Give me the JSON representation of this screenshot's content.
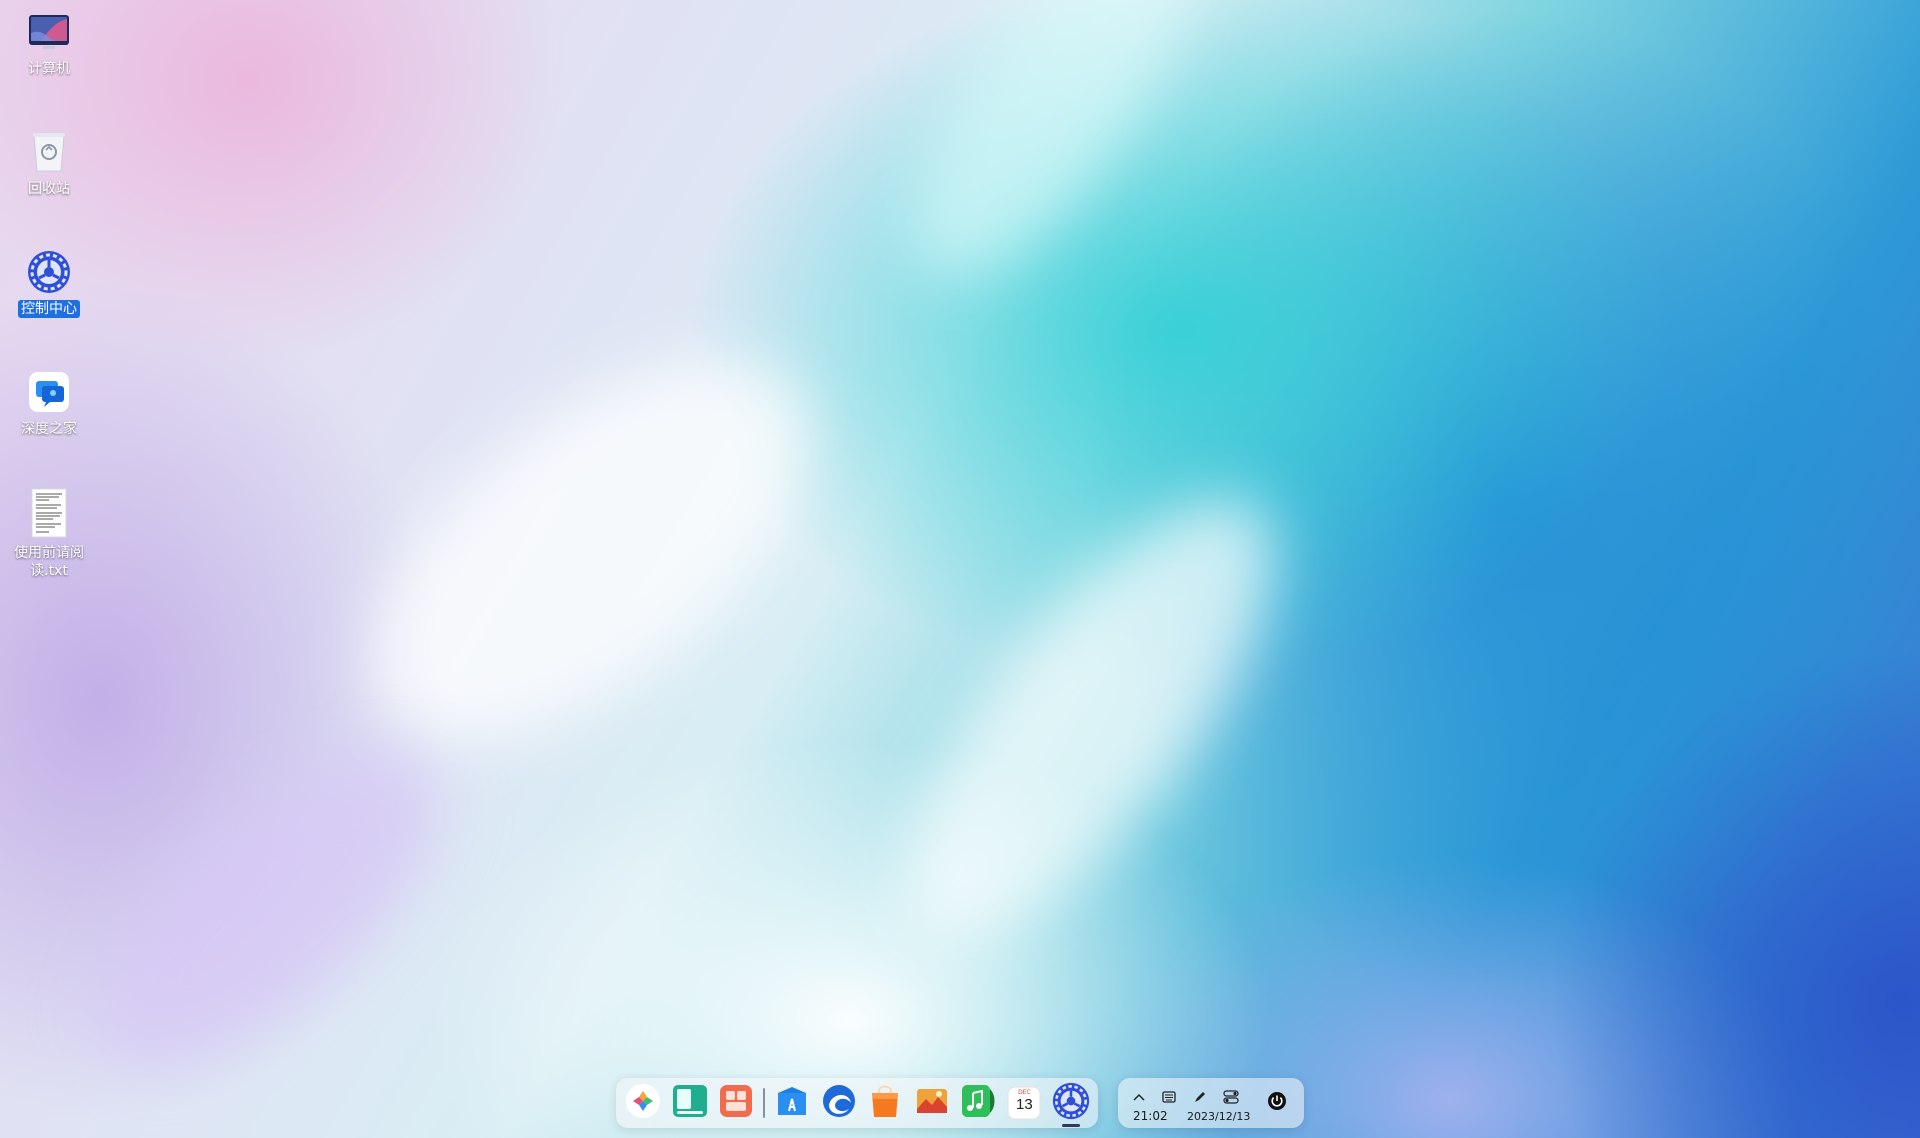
{
  "desktop": {
    "icons": [
      {
        "label": "计算机",
        "icon": "computer-icon",
        "selected": false
      },
      {
        "label": "回收站",
        "icon": "trash-icon",
        "selected": false
      },
      {
        "label": "控制中心",
        "icon": "control-center-icon",
        "selected": true
      },
      {
        "label": "深度之家",
        "icon": "deepin-home-icon",
        "selected": false
      },
      {
        "label": "使用前请阅读.txt",
        "icon": "text-file-icon",
        "selected": false
      }
    ]
  },
  "dock": {
    "apps": [
      {
        "name": "launcher",
        "icon": "launcher-icon"
      },
      {
        "name": "multitasking",
        "icon": "multitasking-icon"
      },
      {
        "name": "file-manager",
        "icon": "file-manager-icon"
      },
      {
        "name": "app-store",
        "icon": "app-store-icon"
      },
      {
        "name": "browser",
        "icon": "browser-icon"
      },
      {
        "name": "shopping",
        "icon": "shopping-bag-icon"
      },
      {
        "name": "image-viewer",
        "icon": "image-viewer-icon"
      },
      {
        "name": "music",
        "icon": "music-icon"
      },
      {
        "name": "calendar",
        "icon": "calendar-icon",
        "day": "13",
        "month": "DEC"
      },
      {
        "name": "control-center",
        "icon": "control-center-icon",
        "running": true
      }
    ]
  },
  "tray": {
    "time": "21:02",
    "date": "2023/12/13"
  },
  "colors": {
    "selection": "#1e6fe0",
    "accent_blue": "#2d9ad6",
    "accent_cyan": "#34d0d6"
  }
}
